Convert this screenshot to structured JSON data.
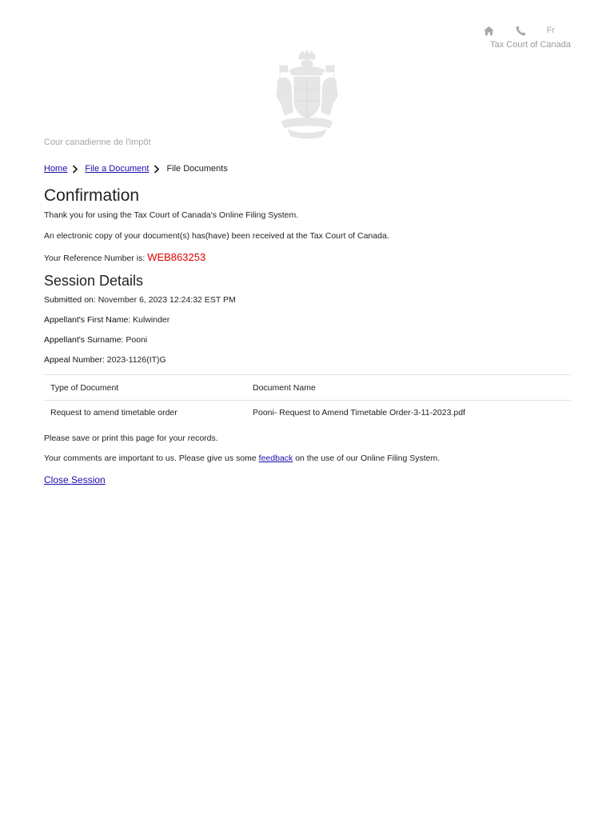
{
  "header": {
    "lang_toggle": "Fr",
    "org_name_en": "Tax Court of Canada",
    "org_name_fr": "Cour canadienne de l'impôt",
    "icons": [
      "home-icon",
      "phone-icon"
    ]
  },
  "breadcrumb": {
    "items": [
      {
        "label": "Home",
        "link": true
      },
      {
        "label": "File a Document",
        "link": true
      },
      {
        "label": "File Documents",
        "link": false
      }
    ]
  },
  "confirmation": {
    "title": "Confirmation",
    "thank_you": "Thank you for using the Tax Court of Canada's Online Filing System.",
    "received": "An electronic copy of your document(s) has(have) been received at the Tax Court of Canada.",
    "reference_label": "Your Reference Number is:",
    "reference_number": "WEB863253"
  },
  "session": {
    "title": "Session Details",
    "submitted_label": "Submitted on:",
    "submitted_value": "November 6, 2023 12:24:32 EST PM",
    "first_name_label": "Appellant's First Name:",
    "first_name_value": "Kulwinder",
    "surname_label": "Appellant's Surname:",
    "surname_value": "Pooni",
    "appeal_label": "Appeal Number:",
    "appeal_value": "2023-1126(IT)G"
  },
  "documents": {
    "columns": [
      "Type of Document",
      "Document Name"
    ],
    "rows": [
      [
        "Request to amend timetable order",
        "Pooni- Request to Amend Timetable Order-3-11-2023.pdf"
      ]
    ]
  },
  "footer": {
    "save_print": "Please save or print this page for your records.",
    "comments_before": "Your comments are important to us. Please give us some ",
    "feedback_link": "feedback",
    "comments_after": " on the use of our Online Filing System.",
    "close_session": "Close Session"
  },
  "colors": {
    "link": "#1a0dab",
    "reference": "#e00000",
    "muted": "#a8a8a8"
  }
}
